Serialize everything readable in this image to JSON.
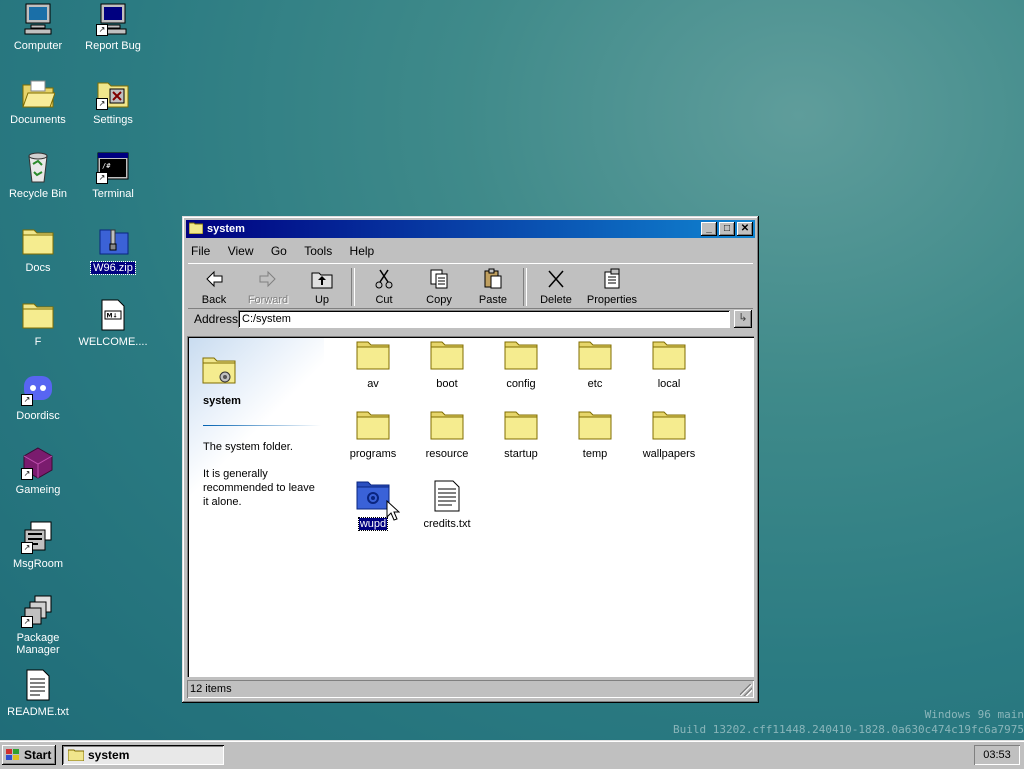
{
  "desktop": {
    "icons": [
      {
        "label": "Computer"
      },
      {
        "label": "Report Bug"
      },
      {
        "label": "Documents"
      },
      {
        "label": "Settings"
      },
      {
        "label": "Recycle Bin"
      },
      {
        "label": "Terminal"
      },
      {
        "label": "Docs"
      },
      {
        "label": "W96.zip",
        "selected": true
      },
      {
        "label": "F"
      },
      {
        "label": "WELCOME...."
      },
      {
        "label": "Doordisc"
      },
      {
        "label": "Gameing"
      },
      {
        "label": "MsgRoom"
      },
      {
        "label": "Package Manager"
      },
      {
        "label": "README.txt"
      }
    ],
    "build_line1": "Windows 96 main",
    "build_line2": "Build 13202.cff11448.240410-1828.0a630c474c19fc6a7975"
  },
  "window": {
    "title": "system",
    "menu": [
      "File",
      "View",
      "Go",
      "Tools",
      "Help"
    ],
    "toolbar": {
      "back": "Back",
      "forward": "Forward",
      "up": "Up",
      "cut": "Cut",
      "copy": "Copy",
      "paste": "Paste",
      "delete": "Delete",
      "properties": "Properties"
    },
    "address_label": "Address",
    "address_value": "C:/system",
    "panel": {
      "title": "system",
      "desc1": "The system folder.",
      "desc2": "It is generally recommended to leave it alone."
    },
    "files": [
      {
        "name": "av",
        "type": "folder"
      },
      {
        "name": "boot",
        "type": "folder"
      },
      {
        "name": "config",
        "type": "folder"
      },
      {
        "name": "etc",
        "type": "folder"
      },
      {
        "name": "local",
        "type": "folder"
      },
      {
        "name": "programs",
        "type": "folder"
      },
      {
        "name": "resource",
        "type": "folder"
      },
      {
        "name": "startup",
        "type": "folder"
      },
      {
        "name": "temp",
        "type": "folder"
      },
      {
        "name": "wallpapers",
        "type": "folder"
      },
      {
        "name": "wupd",
        "type": "special-folder",
        "selected": true
      },
      {
        "name": "credits.txt",
        "type": "text-file"
      }
    ],
    "status": "12 items"
  },
  "taskbar": {
    "start_label": "Start",
    "task_label": "system",
    "clock": "03:53"
  },
  "colors": {
    "titlebar_start": "#000080",
    "titlebar_end": "#1084d0",
    "folder": "#f0e68c",
    "desktop": "#2b7b82"
  }
}
